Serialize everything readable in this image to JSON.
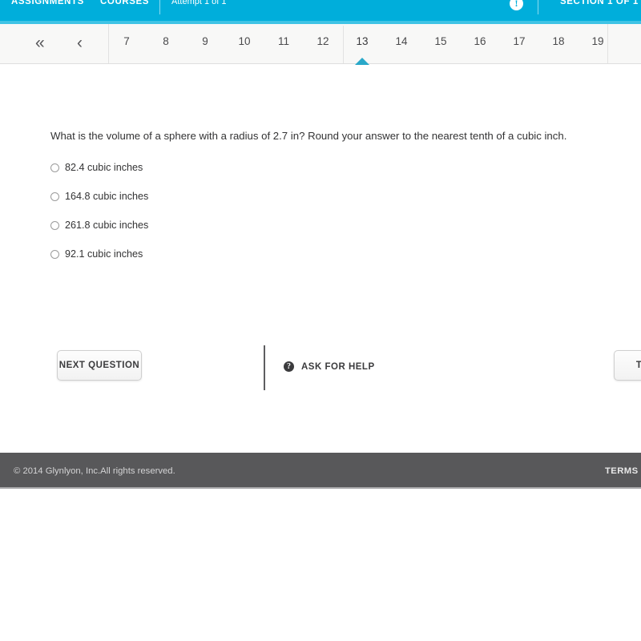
{
  "colors": {
    "header_blue": "#00AEDB",
    "header_band": "#3FC3E5",
    "caret_blue": "#29A8C9",
    "footer_gray": "#58585A",
    "pager_bg": "#F8F8F7",
    "text_dark": "#333334"
  },
  "topbar": {
    "assignments_label": "ASSIGNMENTS",
    "courses_label": "COURSES",
    "attempt_label": "Attempt 1 of 1",
    "info_icon": "info-icon",
    "info_glyph": "!",
    "section_label": "SECTION 1 OF 1"
  },
  "pager": {
    "first_arrow": "«",
    "prev_arrow": "‹",
    "pages": [
      "7",
      "8",
      "9",
      "10",
      "11",
      "12",
      "13",
      "14",
      "15",
      "16",
      "17",
      "18",
      "19"
    ],
    "active_page": "13"
  },
  "question": {
    "text": "What is the volume of a sphere with a radius of 2.7 in? Round your answer to the nearest tenth of a cubic inch.",
    "options": [
      {
        "label": "82.4 cubic inches",
        "selected": false
      },
      {
        "label": "164.8 cubic inches",
        "selected": false
      },
      {
        "label": "261.8 cubic inches",
        "selected": false
      },
      {
        "label": "92.1 cubic inches",
        "selected": false
      }
    ]
  },
  "actions": {
    "next_label": "NEXT QUESTION",
    "help_label": "ASK FOR HELP",
    "help_glyph": "?",
    "turnin_label": "TURN IN"
  },
  "footer": {
    "copyright": "© 2014 Glynlyon, Inc.All rights reserved.",
    "terms_label": "TERMS OF USE"
  }
}
